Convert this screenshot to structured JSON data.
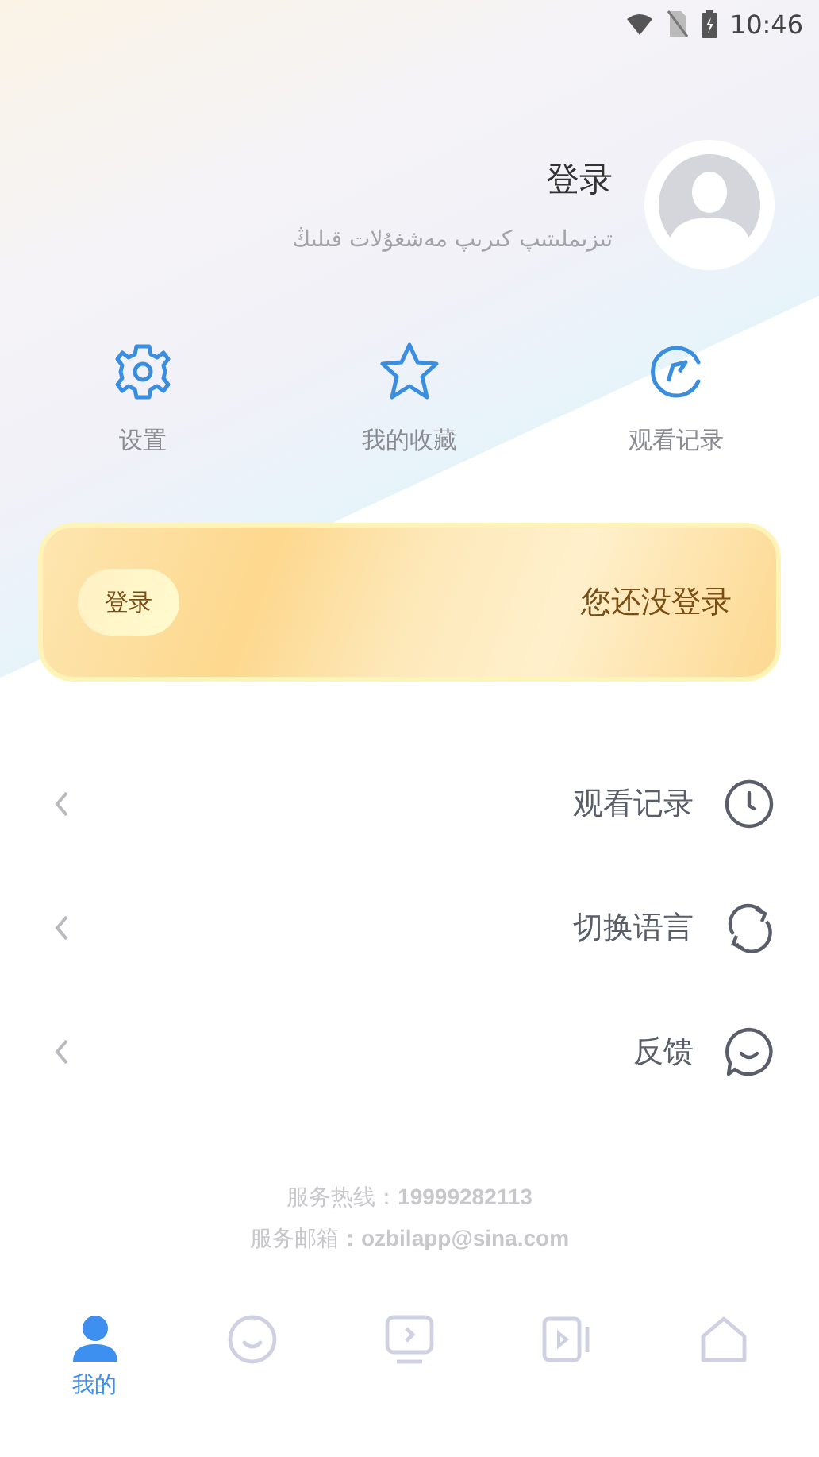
{
  "status_bar": {
    "time": "10:46"
  },
  "profile": {
    "title": "登录",
    "subtitle": "تىزىملىتىپ كىرىپ مەشغۇلات قىلىڭ"
  },
  "shortcuts": [
    {
      "kind": "gear",
      "label": "设置"
    },
    {
      "kind": "star",
      "label": "我的收藏"
    },
    {
      "kind": "compass",
      "label": "观看记录"
    }
  ],
  "login_card": {
    "button": "登录",
    "message": "您还没登录"
  },
  "menu": [
    {
      "kind": "clock",
      "label": "观看记录"
    },
    {
      "kind": "refresh",
      "label": "切换语言"
    },
    {
      "kind": "chat",
      "label": "反馈"
    }
  ],
  "footer": [
    "服务热线：**19999282113**",
    "服务邮箱**：ozbilapp@sina.com**"
  ],
  "nav": [
    {
      "kind": "person",
      "label": "我的",
      "selected": true
    },
    {
      "kind": "smile",
      "selected": false
    },
    {
      "kind": "tv",
      "selected": false
    },
    {
      "kind": "video",
      "selected": false
    },
    {
      "kind": "home",
      "selected": false
    }
  ]
}
